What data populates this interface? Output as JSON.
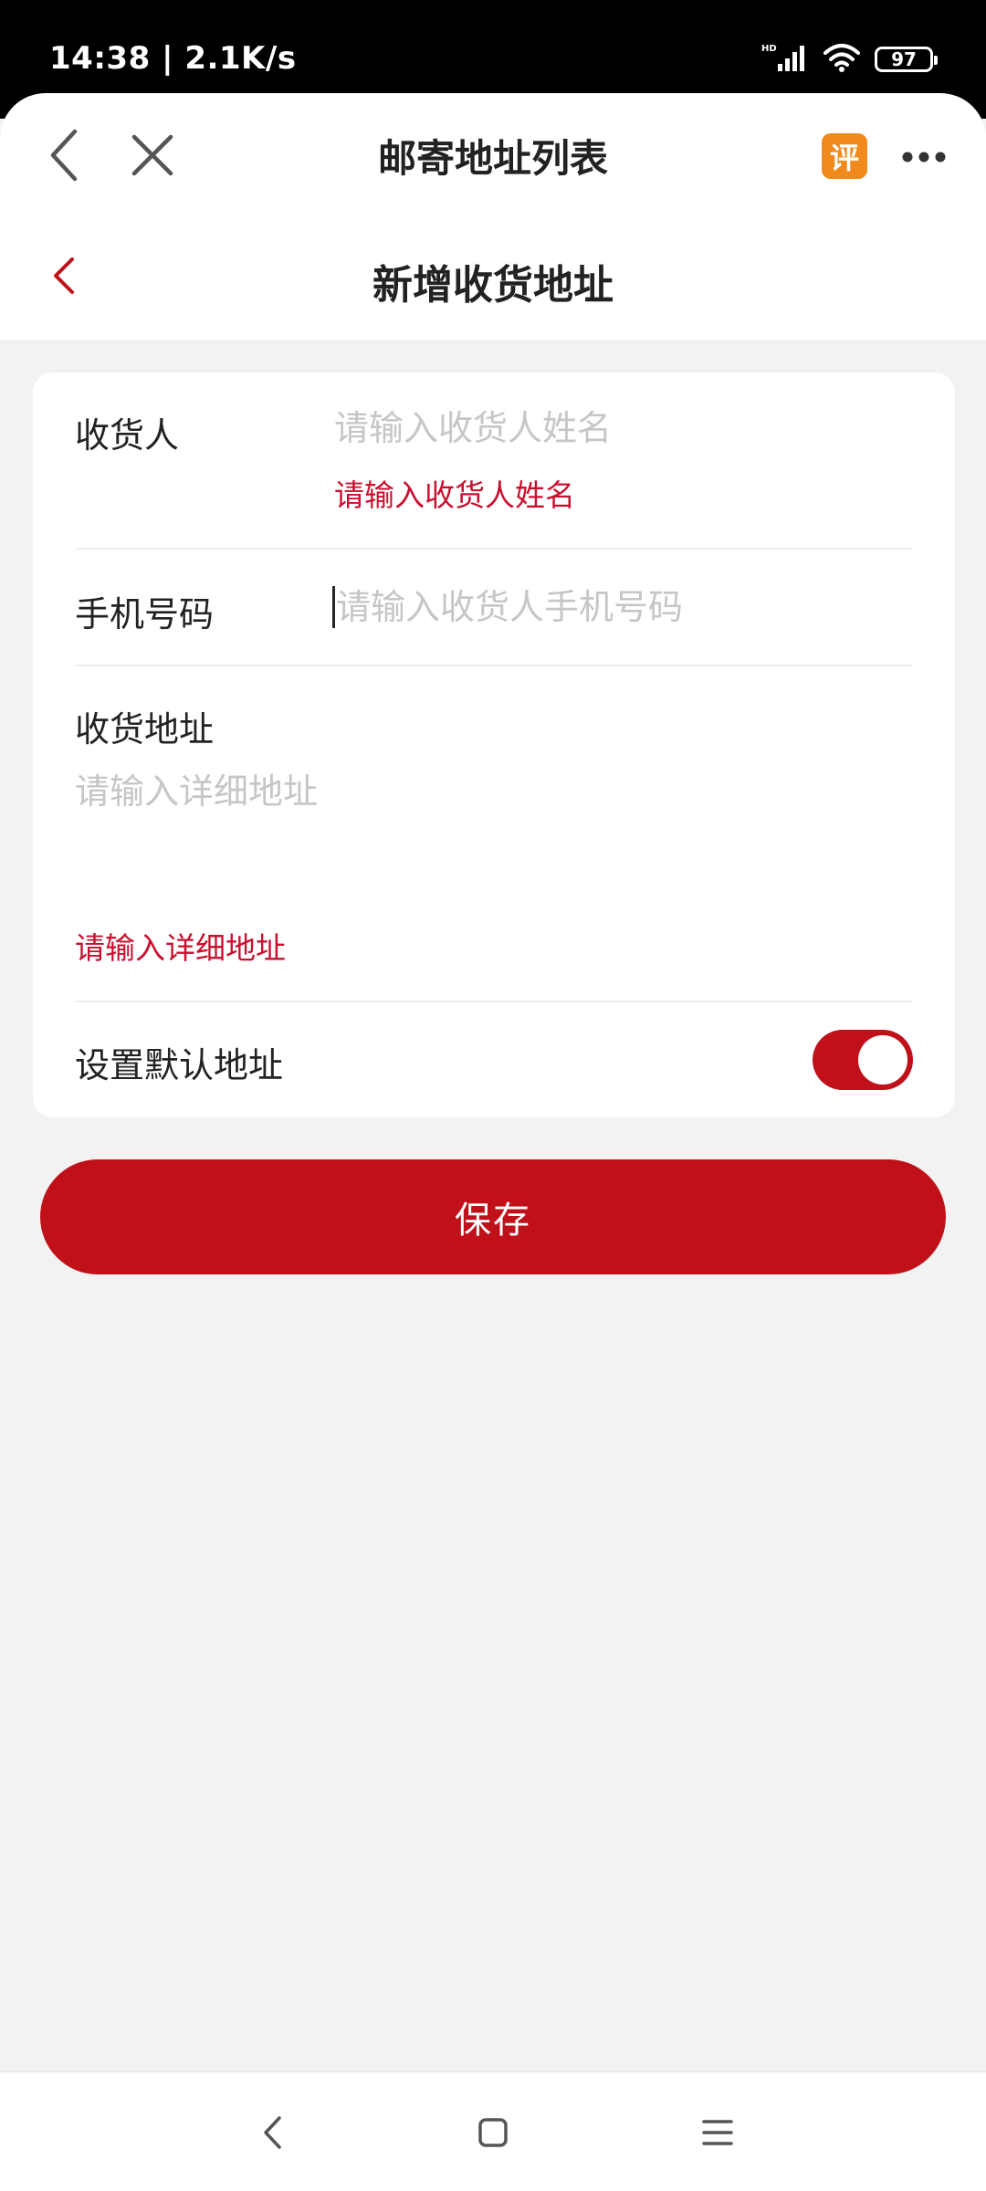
{
  "status_bar": {
    "time": "14:38 | 2.1K/s",
    "battery": "97"
  },
  "navbar": {
    "title": "邮寄地址列表",
    "eval_badge": "评"
  },
  "page": {
    "title": "新增收货地址"
  },
  "form": {
    "receiver": {
      "label": "收货人",
      "placeholder": "请输入收货人姓名",
      "error": "请输入收货人姓名"
    },
    "phone": {
      "label": "手机号码",
      "placeholder": "请输入收货人手机号码"
    },
    "address": {
      "label": "收货地址",
      "placeholder": "请输入详细地址",
      "error": "请输入详细地址"
    },
    "default_address": {
      "label": "设置默认地址",
      "enabled": true
    }
  },
  "actions": {
    "save_label": "保存"
  },
  "colors": {
    "accent": "#c0111a",
    "error": "#c8102e",
    "background": "#f2f2f3"
  },
  "icons": {
    "nav_back": "chevron-left-icon",
    "nav_close": "close-icon",
    "more": "more-horizontal-icon",
    "page_back": "chevron-left-icon",
    "sys_back": "back-icon",
    "sys_home": "home-icon",
    "sys_menu": "menu-icon"
  }
}
